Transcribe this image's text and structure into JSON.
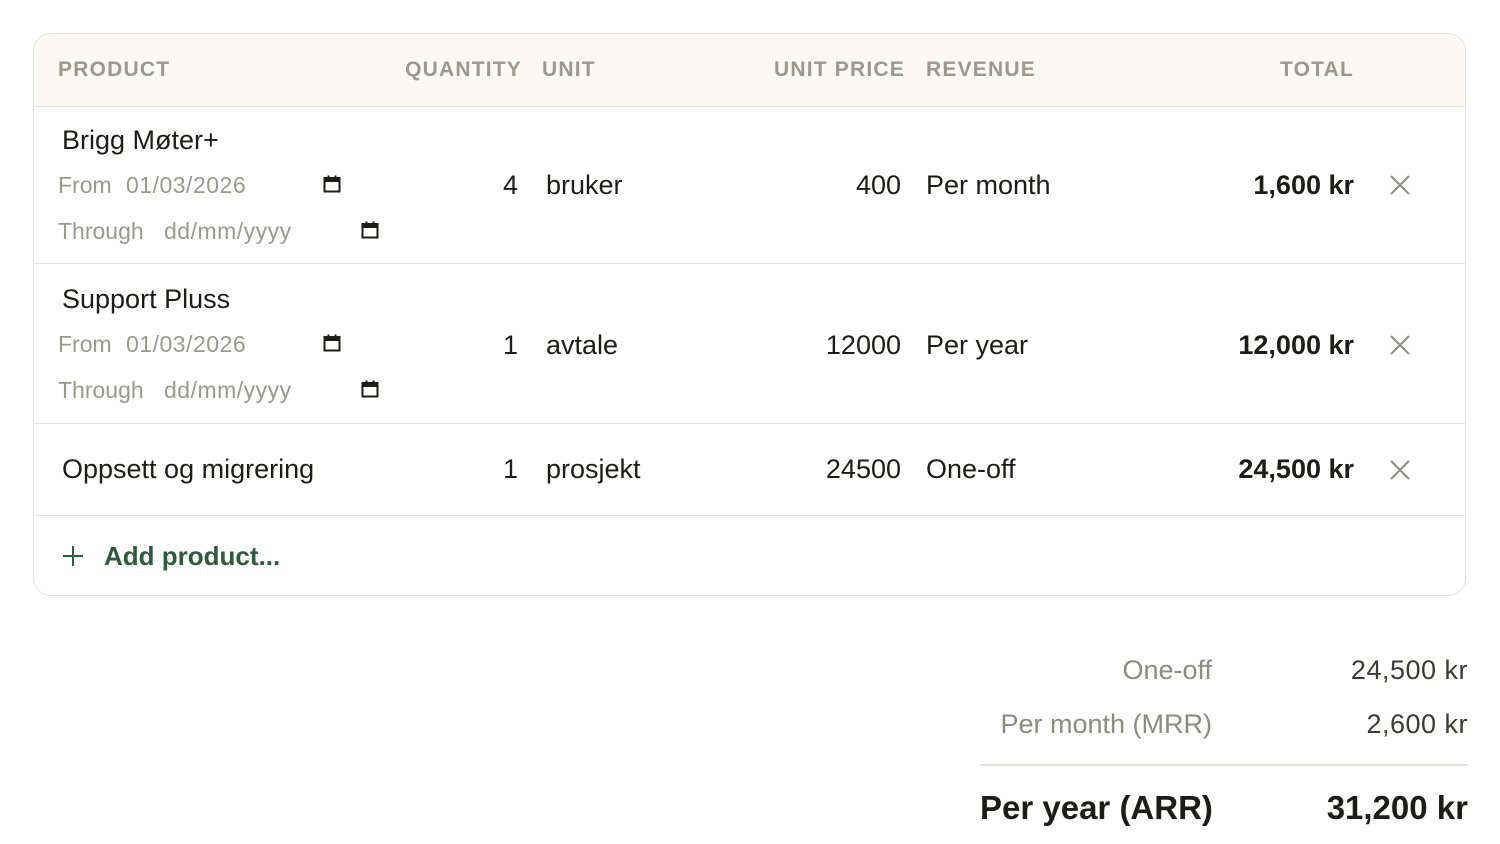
{
  "columns": {
    "product": "PRODUCT",
    "quantity": "QUANTITY",
    "unit": "UNIT",
    "unit_price": "UNIT PRICE",
    "revenue": "REVENUE",
    "total": "TOTAL"
  },
  "rows": [
    {
      "name": "Brigg Møter+",
      "from_label": "From",
      "from_value": "01/03/2026",
      "through_label": "Through",
      "through_placeholder": "dd/mm/yyyy",
      "quantity": "4",
      "unit": "bruker",
      "unit_price": "400",
      "revenue": "Per month",
      "total": "1,600 kr"
    },
    {
      "name": "Support Pluss",
      "from_label": "From",
      "from_value": "01/03/2026",
      "through_label": "Through",
      "through_placeholder": "dd/mm/yyyy",
      "quantity": "1",
      "unit": "avtale",
      "unit_price": "12000",
      "revenue": "Per year",
      "total": "12,000 kr"
    },
    {
      "name": "Oppsett og migrering",
      "quantity": "1",
      "unit": "prosjekt",
      "unit_price": "24500",
      "revenue": "One-off",
      "total": "24,500 kr"
    }
  ],
  "add_product_label": "Add product...",
  "summary": {
    "one_off_label": "One-off",
    "one_off_value": "24,500 kr",
    "mrr_label": "Per month (MRR)",
    "mrr_value": "2,600 kr",
    "arr_label": "Per year (ARR)",
    "arr_value": "31,200 kr"
  },
  "icons": {
    "calendar": "calendar-icon",
    "remove": "close-icon",
    "add": "plus-icon"
  },
  "colors": {
    "accent": "#2f5a3f",
    "border": "#e4e2dc",
    "header_bg": "#faf9f6",
    "muted": "#9a9891"
  }
}
